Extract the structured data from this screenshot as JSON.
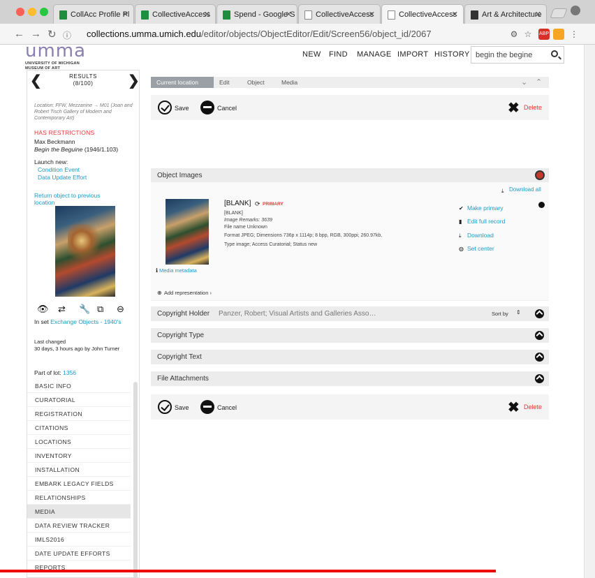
{
  "browser": {
    "tabs": [
      {
        "title": "CollAcc Profile Pl",
        "active": false,
        "favicon": "sheets-icon",
        "color": "#1e8e3e"
      },
      {
        "title": "CollectiveAccess",
        "active": false,
        "favicon": "sheets-icon",
        "color": "#1e8e3e"
      },
      {
        "title": "Spend - Google S",
        "active": false,
        "favicon": "sheets-icon",
        "color": "#1e8e3e"
      },
      {
        "title": "CollectiveAccess",
        "active": false,
        "favicon": "page-icon",
        "color": "#ffffff"
      },
      {
        "title": "CollectiveAccess",
        "active": true,
        "favicon": "page-icon",
        "color": "#ffffff"
      },
      {
        "title": "Art & Architecture",
        "active": false,
        "favicon": "art-icon",
        "color": "#333333"
      }
    ],
    "url_host": "collections.umma.umich.edu",
    "url_path": "/editor/objects/ObjectEditor/Edit/Screen56/object_id/2067"
  },
  "header": {
    "logo_word": "umma",
    "logo_line1": "UNIVERSITY OF MICHIGAN",
    "logo_line2": "MUSEUM OF ART",
    "nav": [
      "NEW",
      "FIND",
      "MANAGE",
      "IMPORT",
      "HISTORY"
    ],
    "search_value": "begin the begine"
  },
  "sidebar": {
    "results_label": "RESULTS",
    "results_count": "(8/100)",
    "location": "Location: FFW, Mezzanine → M01 (Joan and Robert Tisch Gallery of Modern and Contemporary Art)",
    "restrictions": "HAS RESTRICTIONS",
    "artist": "Max Beckmann",
    "title": "Begin the Beguine",
    "title_suffix": " (1946/1.103)",
    "launch_new": "Launch new:",
    "launch_links": [
      "Condition Event",
      "Data Update Effort"
    ],
    "return_link": "Return object to previous location",
    "in_set_prefix": "In set ",
    "in_set_link": "Exchange Objects - 1940's",
    "last_changed": "Last changed",
    "last_changed_detail": "30 days, 3 hours ago by John Turner",
    "part_of_lot": "Part of lot: ",
    "lot_number": "1356",
    "nav_items": [
      "BASIC INFO",
      "CURATORIAL",
      "REGISTRATION",
      "CITATIONS",
      "LOCATIONS",
      "INVENTORY",
      "INSTALLATION",
      "EMBARK LEGACY FIELDS",
      "RELATIONSHIPS",
      "MEDIA",
      "DATA REVIEW TRACKER",
      "IMLS2016",
      "DATE UPDATE EFFORTS",
      "REPORTS"
    ],
    "active_nav": "MEDIA"
  },
  "main": {
    "breadcrumbs": [
      "Current location",
      "Edit",
      "Object",
      "Media"
    ],
    "save_label": "Save",
    "cancel_label": "Cancel",
    "delete_label": "Delete",
    "object_images_label": "Object Images",
    "download_all": "Download all",
    "media": {
      "blank_title": "[BLANK]",
      "primary_badge": "PRIMARY",
      "line1": "[BLANK]",
      "remarks": "Image Remarks: 3639",
      "file_name": "File name Unknown",
      "format": "Format JPEG; Dimensions 736p x 1114p; 8 bpp, RGB, 300ppi; 260.97kb,",
      "type": "Type image; Access Curatorial; Status new",
      "media_metadata": "Media metadata",
      "actions": [
        "Make primary",
        "Edit full record",
        "Download",
        "Set center"
      ],
      "add_representation": "Add representation ›"
    },
    "sections": [
      {
        "label": "Copyright Holder",
        "value": "Panzer, Robert; Visual Artists and Galleries Asso…",
        "sort_by": "Sort by"
      },
      {
        "label": "Copyright Type"
      },
      {
        "label": "Copyright Text"
      },
      {
        "label": "File Attachments"
      }
    ]
  },
  "colors": {
    "accent": "#1a9bc8",
    "danger": "#e33333",
    "brand": "#8a7fae"
  }
}
